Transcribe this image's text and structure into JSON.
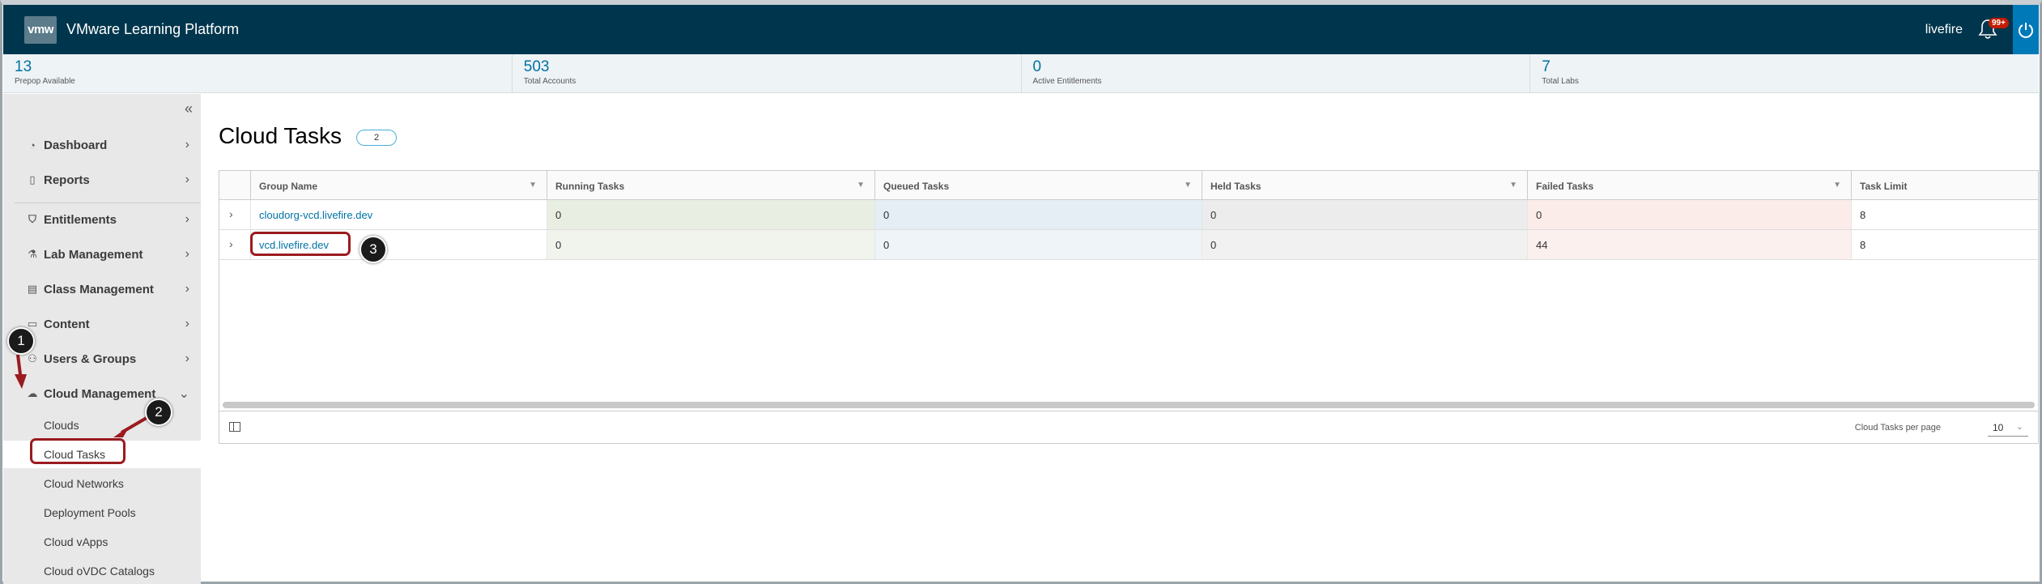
{
  "header": {
    "logo_text": "vmw",
    "title": "VMware Learning Platform",
    "username": "livefire",
    "notification_count": "99+",
    "colors": {
      "bar": "#00364d",
      "power": "#0079b8",
      "badge": "#c21d00"
    }
  },
  "stats": [
    {
      "value": "13",
      "label": "Prepop Available"
    },
    {
      "value": "503",
      "label": "Total Accounts"
    },
    {
      "value": "0",
      "label": "Active Entitlements"
    },
    {
      "value": "7",
      "label": "Total Labs"
    }
  ],
  "sidebar": {
    "items": [
      {
        "label": "Dashboard",
        "icon": "dashboard-icon"
      },
      {
        "label": "Reports",
        "icon": "document-icon"
      },
      {
        "label": "Entitlements",
        "icon": "shield-check-icon"
      },
      {
        "label": "Lab Management",
        "icon": "flask-icon"
      },
      {
        "label": "Class Management",
        "icon": "clipboard-icon"
      },
      {
        "label": "Content",
        "icon": "folder-icon"
      },
      {
        "label": "Users & Groups",
        "icon": "users-icon"
      },
      {
        "label": "Cloud Management",
        "icon": "cloud-icon"
      }
    ],
    "sub_items": [
      {
        "label": "Clouds"
      },
      {
        "label": "Cloud Tasks",
        "active": true
      },
      {
        "label": "Cloud Networks"
      },
      {
        "label": "Deployment Pools"
      },
      {
        "label": "Cloud vApps"
      },
      {
        "label": "Cloud oVDC Catalogs"
      }
    ]
  },
  "main": {
    "title": "Cloud Tasks",
    "count": "2",
    "columns": [
      "Group Name",
      "Running Tasks",
      "Queued Tasks",
      "Held Tasks",
      "Failed Tasks",
      "Task Limit"
    ],
    "rows": [
      {
        "group": "cloudorg-vcd.livefire.dev",
        "running": "0",
        "queued": "0",
        "held": "0",
        "failed": "0",
        "limit": "8"
      },
      {
        "group": "vcd.livefire.dev",
        "running": "0",
        "queued": "0",
        "held": "0",
        "failed": "44",
        "limit": "8"
      }
    ],
    "footer": {
      "per_page_label": "Cloud Tasks per page",
      "per_page_value": "10"
    }
  },
  "callouts": [
    "1",
    "2",
    "3"
  ]
}
